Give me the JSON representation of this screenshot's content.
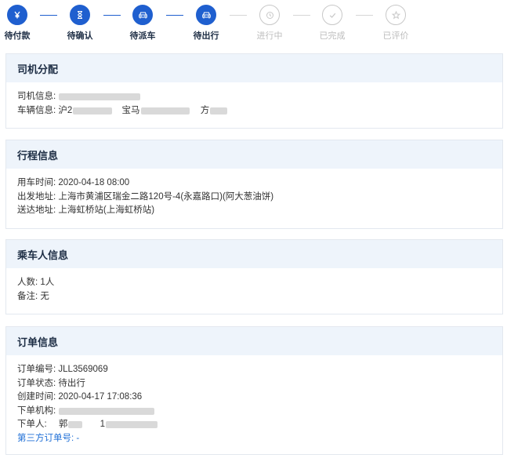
{
  "steps": [
    {
      "label": "待付款",
      "icon": "yen-icon",
      "state": "done"
    },
    {
      "label": "待确认",
      "icon": "hourglass-icon",
      "state": "done"
    },
    {
      "label": "待派车",
      "icon": "car-icon",
      "state": "done"
    },
    {
      "label": "待出行",
      "icon": "car-icon",
      "state": "done"
    },
    {
      "label": "进行中",
      "icon": "clock-icon",
      "state": "todo"
    },
    {
      "label": "已完成",
      "icon": "check-icon",
      "state": "todo"
    },
    {
      "label": "已评价",
      "icon": "star-icon",
      "state": "todo"
    }
  ],
  "colors": {
    "accent": "#1f5fcf",
    "header_bg": "#eef4fb",
    "inactive": "#c8c8c8",
    "link": "#1f6fd6"
  },
  "driver": {
    "title": "司机分配",
    "driver_info_label": "司机信息:",
    "vehicle_info_label": "车辆信息:",
    "vehicle_plate_prefix": "沪2",
    "vehicle_brand_prefix": "宝马",
    "vehicle_color_prefix": "方"
  },
  "trip": {
    "title": "行程信息",
    "time_label": "用车时间:",
    "time": "2020-04-18 08:00",
    "from_label": "出发地址:",
    "from": "上海市黄浦区瑞金二路120号-4(永嘉路口)(阿大葱油饼)",
    "to_label": "送达地址:",
    "to": "上海虹桥站(上海虹桥站)"
  },
  "passenger": {
    "title": "乘车人信息",
    "count_label": "人数:",
    "count": "1人",
    "note_label": "备注:",
    "note": "无"
  },
  "order": {
    "title": "订单信息",
    "number_label": "订单编号:",
    "number": "JLL3569069",
    "status_label": "订单状态:",
    "status": "待出行",
    "created_label": "创建时间:",
    "created": "2020-04-17 17:08:36",
    "org_label": "下单机构:",
    "person_label": "下单人:",
    "person_prefix": "郭",
    "phone_prefix": "1",
    "third_party_label": "第三方订单号:",
    "third_party": "-"
  }
}
